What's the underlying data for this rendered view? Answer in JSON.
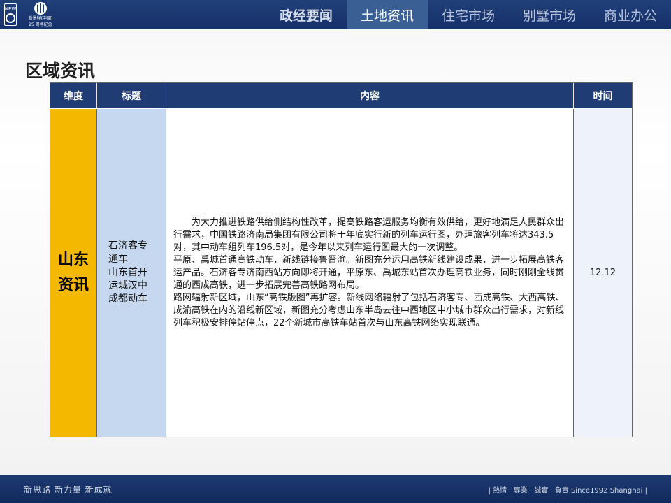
{
  "header": {
    "logo": {
      "mark_text": "NEW",
      "subtext": "新景祥(中國)",
      "anniversary_text": "25 周年纪念"
    },
    "nav": [
      {
        "label": "政经要闻",
        "state": "bold"
      },
      {
        "label": "土地资讯",
        "state": "active"
      },
      {
        "label": "住宅市场",
        "state": "normal"
      },
      {
        "label": "别墅市场",
        "state": "normal"
      },
      {
        "label": "商业办公",
        "state": "normal"
      }
    ]
  },
  "page": {
    "title": "区域资讯"
  },
  "table": {
    "headers": [
      "维度",
      "标题",
      "内容",
      "时间"
    ],
    "row": {
      "dimension": [
        "山东",
        "资讯"
      ],
      "title_lines": [
        "石济客专",
        "通车",
        "山东首开",
        "运城汉中",
        "成都动车"
      ],
      "content_lines": [
        "为大力推进铁路供给侧结构性改革，提高铁路客运服务均衡有效供给，更好地满足人民群众出行需求，中国铁路济南局集团有限公司将于年底实行新的列车运行图，办理旅客列车将达343.5对，其中动车组列车196.5对，是今年以来列车运行图最大的一次调整。",
        "平原、禹城首通高铁动车，新线链接鲁晋渝。新图充分运用高铁新线建设成果，进一步拓展高铁客运产品。石济客专济南西站方向即将开通，平原东、禹城东站首次办理高铁业务，同时刚刚全线贯通的西成高铁，进一步拓展完善高铁路网布局。",
        "路网辐射新区域，山东“高铁版图”再扩容。新线网络辐射了包括石济客专、西成高铁、大西高铁、成渝高铁在内的沿线新区域，新图充分考虑山东半岛去往中西地区中小城市群众出行需求，对新线列车积极安排停站停点，22个新城市高铁车站首次与山东高铁网络实现联通。"
      ],
      "time": "12.12"
    }
  },
  "footer": {
    "slogan": "新思路  新力量  新成就",
    "motto": "|  熱情 · 專業 · 誠實 · 負責  Since1992 Shanghai  |"
  },
  "colors": {
    "header_bg": "#1a3670",
    "nav_active_bg": "#3a5f95",
    "table_header_bg": "#1f3c75",
    "dimension_bg": "#f5b800",
    "title_col_bg": "#c5d8ef"
  }
}
